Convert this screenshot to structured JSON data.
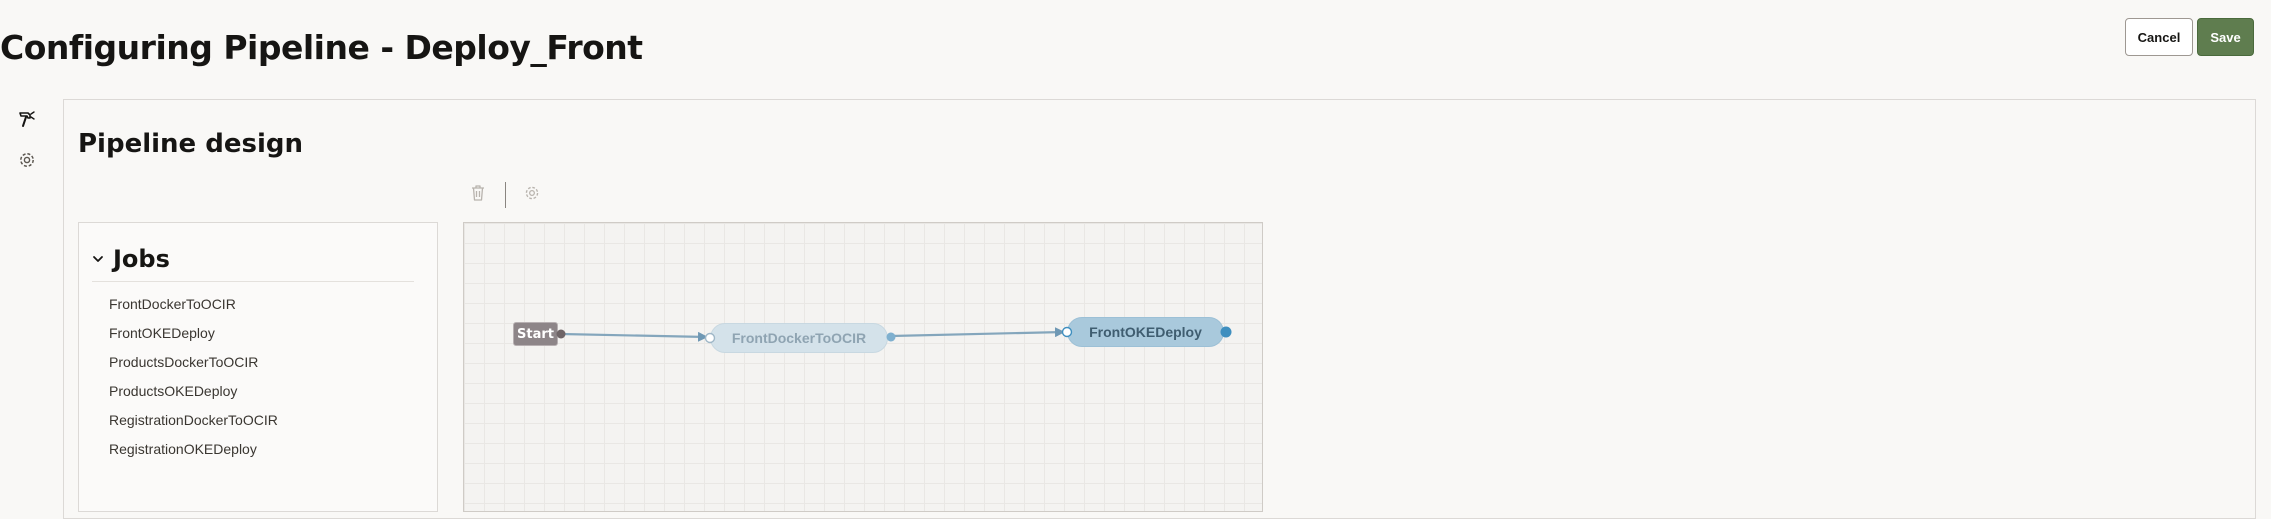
{
  "header": {
    "title": "Configuring Pipeline - Deploy_Front",
    "cancel_label": "Cancel",
    "save_label": "Save"
  },
  "left_rail": {
    "items": [
      {
        "icon": "hammer-icon"
      },
      {
        "icon": "gear-icon"
      }
    ]
  },
  "main": {
    "section_title": "Pipeline design",
    "toolbar": {
      "items": [
        {
          "icon": "trash-icon",
          "enabled": false
        },
        {
          "icon": "gear-icon",
          "enabled": false
        }
      ]
    },
    "jobs_panel": {
      "title": "Jobs",
      "expanded": true,
      "items": [
        "FrontDockerToOCIR",
        "FrontOKEDeploy",
        "ProductsDockerToOCIR",
        "ProductsOKEDeploy",
        "RegistrationDockerToOCIR",
        "RegistrationOKEDeploy"
      ]
    },
    "canvas": {
      "start_label": "Start",
      "nodes": [
        {
          "label": "FrontDockerToOCIR",
          "state": "faded"
        },
        {
          "label": "FrontOKEDeploy",
          "state": "selected"
        }
      ]
    }
  },
  "colors": {
    "save_button": "#5f7d4f",
    "start_node": "#8d8588",
    "job_node_faded": "#d4e2ea",
    "job_node_selected": "#a9c9dc",
    "edge": "#84a6bc",
    "connector": "#3f8fbf"
  }
}
